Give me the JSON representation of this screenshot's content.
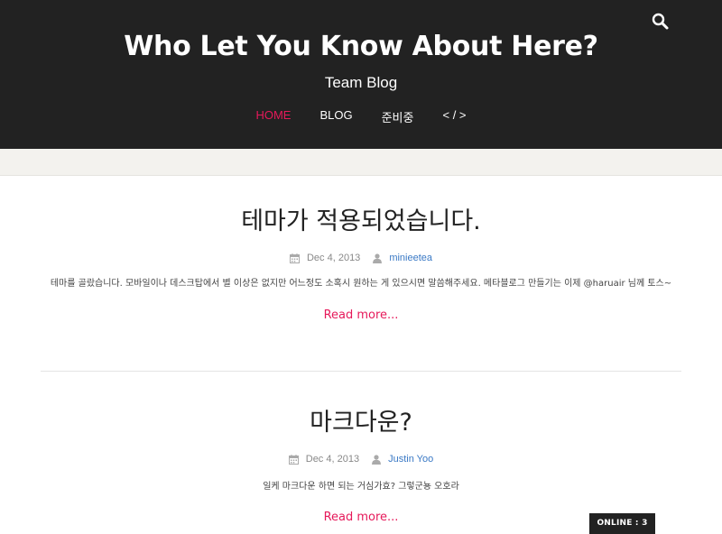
{
  "header": {
    "title": "Who Let You Know About Here?",
    "subtitle": "Team Blog",
    "search_icon": "search-icon"
  },
  "nav": {
    "items": [
      {
        "label": "HOME",
        "active": true
      },
      {
        "label": "BLOG",
        "active": false
      },
      {
        "label": "준비중",
        "active": false
      },
      {
        "label": "< / >",
        "active": false
      }
    ]
  },
  "posts": [
    {
      "title": "테마가 적용되었습니다.",
      "date": "Dec 4, 2013",
      "author": "minieetea",
      "excerpt": "테마를 골랐습니다. 모바일이나 데스크탑에서 별 이상은 없지만 어느정도 소혹시 원하는 게 있으시면 말씀해주세요. 메타블로그 만들기는 이제 @haruair 님께 토스~",
      "read_more": "Read more..."
    },
    {
      "title": "마크다운?",
      "date": "Dec 4, 2013",
      "author": "Justin Yoo",
      "excerpt": "일케 마크다운 하면 되는 거심가효? 그렇군뇽 오호라",
      "read_more": "Read more..."
    }
  ],
  "online": {
    "label": "ONLINE : 3"
  },
  "colors": {
    "header_bg": "#222222",
    "accent": "#e6195a",
    "author_link": "#3a79c5",
    "band": "#f3f2ee"
  }
}
